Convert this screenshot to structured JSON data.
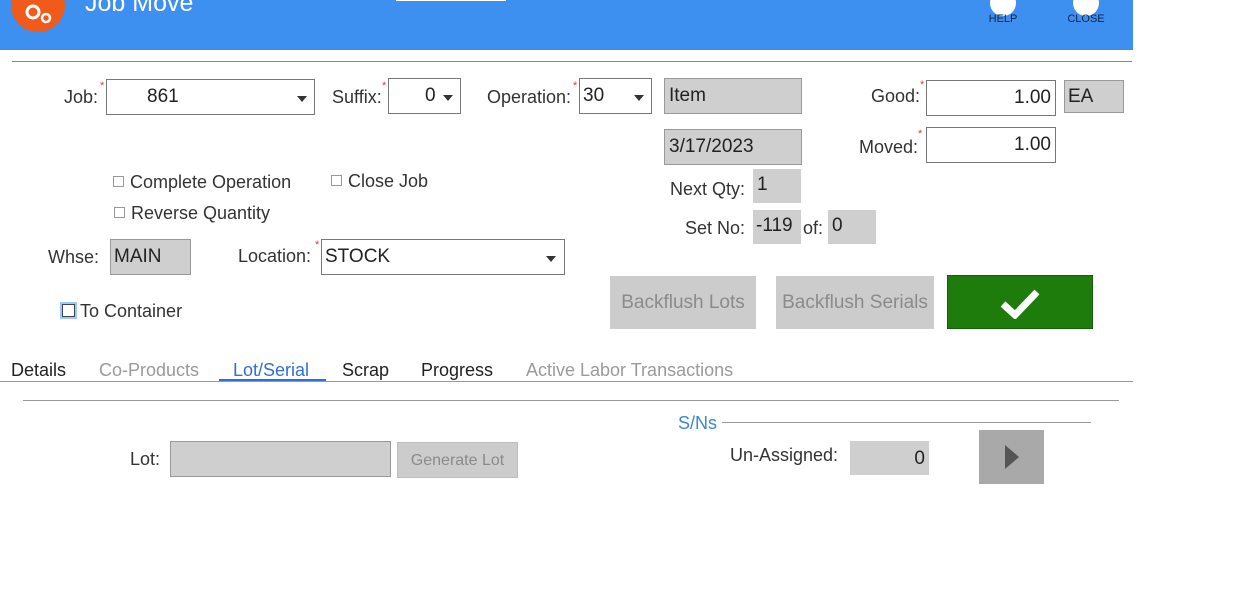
{
  "header": {
    "title": "Job Move",
    "help_label": "HELP",
    "close_label": "CLOSE",
    "background": "#3d8ff0",
    "app_icon": "gears-icon"
  },
  "form": {
    "job": {
      "label": "Job:",
      "value": "861"
    },
    "suffix": {
      "label": "Suffix:",
      "value": "0"
    },
    "operation": {
      "label": "Operation:",
      "value": "30"
    },
    "item": {
      "value": "Item"
    },
    "good": {
      "label": "Good:",
      "value": "1.00",
      "uom": "EA"
    },
    "date": {
      "value": "3/17/2023"
    },
    "moved": {
      "label": "Moved:",
      "value": "1.00"
    },
    "next_qty": {
      "label": "Next Qty:",
      "value": "1"
    },
    "set_no": {
      "label": "Set No:",
      "value": "-119",
      "of_label": "of:",
      "of_value": "0"
    },
    "complete_operation": {
      "label": "Complete Operation",
      "checked": false
    },
    "close_job": {
      "label": "Close Job",
      "checked": false
    },
    "reverse_quantity": {
      "label": "Reverse Quantity",
      "checked": false
    },
    "whse": {
      "label": "Whse:",
      "value": "MAIN"
    },
    "location": {
      "label": "Location:",
      "value": "STOCK"
    },
    "to_container": {
      "label": "To Container",
      "checked": false
    },
    "backflush_lots_label": "Backflush Lots",
    "backflush_serials_label": "Backflush Serials",
    "confirm_color": "#1e7c0c"
  },
  "tabs": [
    {
      "label": "Details",
      "state": "normal"
    },
    {
      "label": "Co-Products",
      "state": "disabled"
    },
    {
      "label": "Lot/Serial",
      "state": "active"
    },
    {
      "label": "Scrap",
      "state": "normal"
    },
    {
      "label": "Progress",
      "state": "normal"
    },
    {
      "label": "Active Labor Transactions",
      "state": "disabled"
    }
  ],
  "lot_serial": {
    "lot_label": "Lot:",
    "lot_value": "",
    "generate_lot_label": "Generate Lot",
    "sns_title": "S/Ns",
    "unassigned_label": "Un-Assigned:",
    "unassigned_value": "0"
  }
}
